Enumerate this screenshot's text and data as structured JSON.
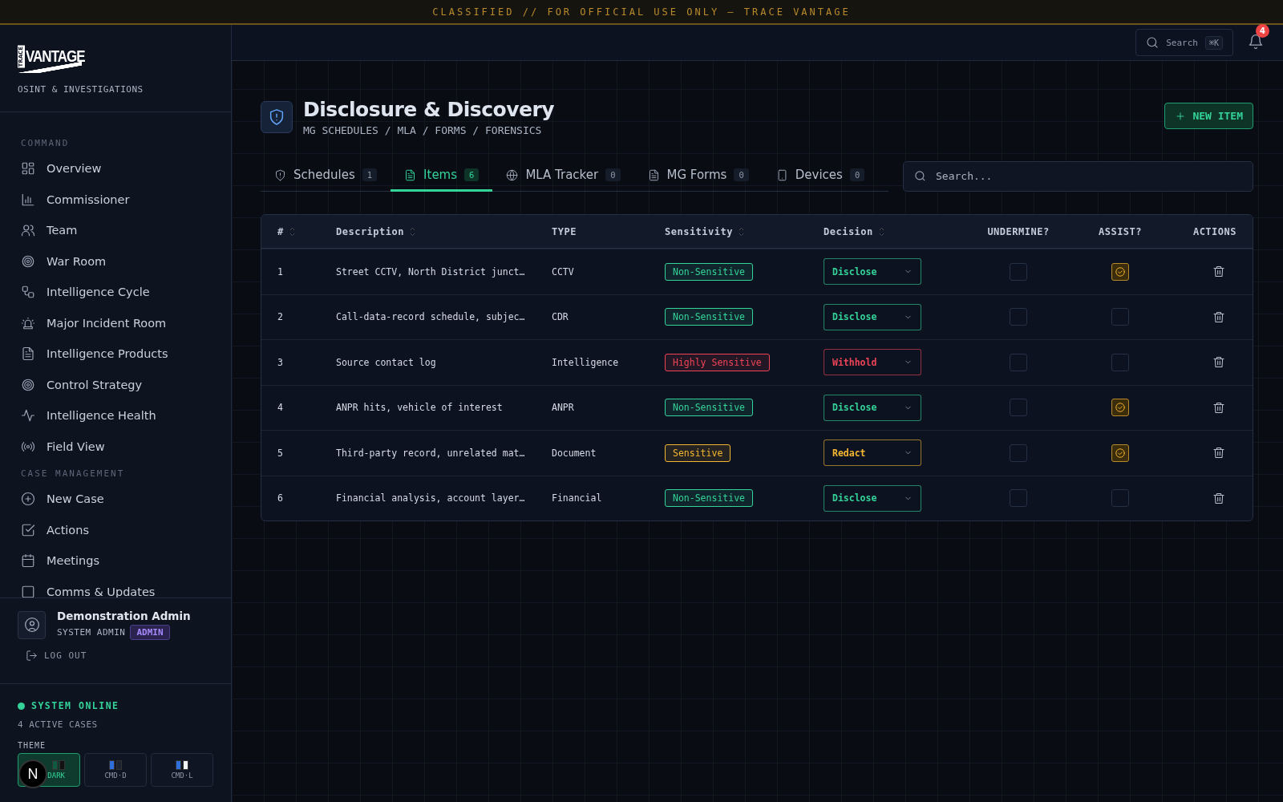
{
  "banner": {
    "text": "CLASSIFIED // FOR OFFICIAL USE ONLY — TRACE VANTAGE"
  },
  "sidebar": {
    "logo": {
      "small": "TRACE",
      "big": "VANTAGE"
    },
    "tagline": "OSINT & INVESTIGATIONS",
    "sections": [
      {
        "title": "COMMAND",
        "items": [
          {
            "label": "Overview",
            "selected": false
          },
          {
            "label": "Commissioner",
            "selected": false
          },
          {
            "label": "Team",
            "selected": false
          },
          {
            "label": "War Room",
            "selected": false
          },
          {
            "label": "Intelligence Cycle",
            "selected": false
          },
          {
            "label": "Major Incident Room",
            "selected": false
          },
          {
            "label": "Intelligence Products",
            "selected": false
          },
          {
            "label": "Control Strategy",
            "selected": false
          },
          {
            "label": "Intelligence Health",
            "selected": false
          },
          {
            "label": "Field View",
            "selected": false
          }
        ]
      },
      {
        "title": "CASE MANAGEMENT",
        "items": [
          {
            "label": "New Case",
            "selected": false
          },
          {
            "label": "Actions",
            "selected": false
          },
          {
            "label": "Meetings",
            "selected": false
          },
          {
            "label": "Comms & Updates",
            "selected": false
          }
        ]
      }
    ],
    "user": {
      "name": "Demonstration Admin",
      "role": "SYSTEM ADMIN",
      "badge": "ADMIN",
      "logout": "LOG OUT"
    },
    "status": {
      "text": "SYSTEM ONLINE",
      "cases": "4 ACTIVE CASES"
    },
    "theme": {
      "label": "THEME",
      "options": [
        {
          "label": "DARK",
          "selected": true
        },
        {
          "label": "CMD·D",
          "selected": false
        },
        {
          "label": "CMD·L",
          "selected": false
        }
      ]
    }
  },
  "dev_badge": {
    "text": "N"
  },
  "topbar": {
    "search": {
      "label": "Search",
      "shortcut": "⌘K"
    },
    "notifications": {
      "count": "4"
    }
  },
  "header": {
    "title": "Disclosure & Discovery",
    "breadcrumb": "MG SCHEDULES / MLA / FORMS / FORENSICS",
    "new_button": "NEW ITEM"
  },
  "tabs": [
    {
      "label": "Schedules",
      "count": "1",
      "selected": false
    },
    {
      "label": "Items",
      "count": "6",
      "selected": true
    },
    {
      "label": "MLA Tracker",
      "count": "0",
      "selected": false
    },
    {
      "label": "MG Forms",
      "count": "0",
      "selected": false
    },
    {
      "label": "Devices",
      "count": "0",
      "selected": false
    }
  ],
  "search": {
    "placeholder": "Search..."
  },
  "table": {
    "columns": [
      {
        "label": "#",
        "sortable": true
      },
      {
        "label": "Description",
        "sortable": true
      },
      {
        "label": "TYPE",
        "sortable": false
      },
      {
        "label": "Sensitivity",
        "sortable": true
      },
      {
        "label": "Decision",
        "sortable": true
      },
      {
        "label": "UNDERMINE?",
        "sortable": false
      },
      {
        "label": "ASSIST?",
        "sortable": false
      },
      {
        "label": "ACTIONS",
        "sortable": false
      }
    ],
    "rows": [
      {
        "number": "1",
        "description": "Street CCTV, North District junct…",
        "type": "CCTV",
        "sensitivity": {
          "label": "Non-Sensitive",
          "color": "#34d399"
        },
        "decision": {
          "label": "Disclose",
          "color": "#34d399"
        },
        "undermine": false,
        "assist": true
      },
      {
        "number": "2",
        "description": "Call-data-record schedule, subjec…",
        "type": "CDR",
        "sensitivity": {
          "label": "Non-Sensitive",
          "color": "#34d399"
        },
        "decision": {
          "label": "Disclose",
          "color": "#34d399"
        },
        "undermine": false,
        "assist": false
      },
      {
        "number": "3",
        "description": "Source contact log",
        "type": "Intelligence",
        "sensitivity": {
          "label": "Highly Sensitive",
          "color": "#ef4457"
        },
        "decision": {
          "label": "Withhold",
          "color": "#ef4457"
        },
        "undermine": false,
        "assist": false
      },
      {
        "number": "4",
        "description": "ANPR hits, vehicle of interest",
        "type": "ANPR",
        "sensitivity": {
          "label": "Non-Sensitive",
          "color": "#34d399"
        },
        "decision": {
          "label": "Disclose",
          "color": "#34d399"
        },
        "undermine": false,
        "assist": true
      },
      {
        "number": "5",
        "description": "Third-party record, unrelated mat…",
        "type": "Document",
        "sensitivity": {
          "label": "Sensitive",
          "color": "#f5b731"
        },
        "decision": {
          "label": "Redact",
          "color": "#f5b731"
        },
        "undermine": false,
        "assist": true
      },
      {
        "number": "6",
        "description": "Financial analysis, account layer…",
        "type": "Financial",
        "sensitivity": {
          "label": "Non-Sensitive",
          "color": "#34d399"
        },
        "decision": {
          "label": "Disclose",
          "color": "#34d399"
        },
        "undermine": false,
        "assist": false
      }
    ]
  }
}
